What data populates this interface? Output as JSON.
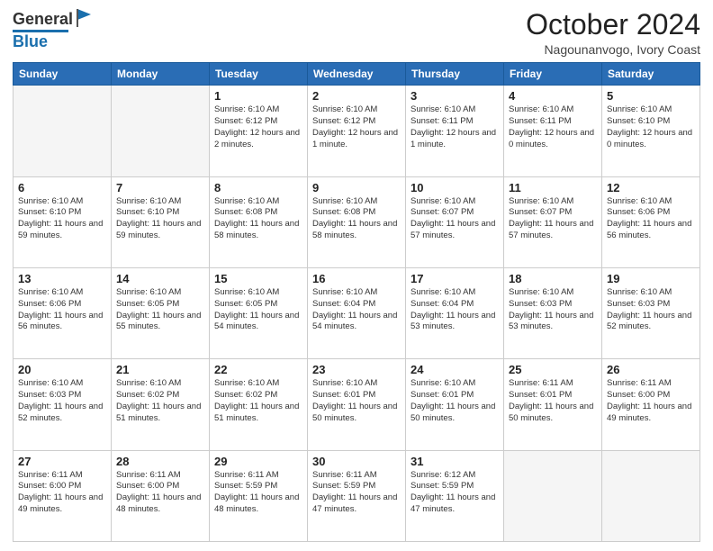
{
  "header": {
    "logo_general": "General",
    "logo_blue": "Blue",
    "month_title": "October 2024",
    "location": "Nagounanvogo, Ivory Coast"
  },
  "days_of_week": [
    "Sunday",
    "Monday",
    "Tuesday",
    "Wednesday",
    "Thursday",
    "Friday",
    "Saturday"
  ],
  "weeks": [
    [
      {
        "day": "",
        "info": ""
      },
      {
        "day": "",
        "info": ""
      },
      {
        "day": "1",
        "info": "Sunrise: 6:10 AM\nSunset: 6:12 PM\nDaylight: 12 hours\nand 2 minutes."
      },
      {
        "day": "2",
        "info": "Sunrise: 6:10 AM\nSunset: 6:12 PM\nDaylight: 12 hours\nand 1 minute."
      },
      {
        "day": "3",
        "info": "Sunrise: 6:10 AM\nSunset: 6:11 PM\nDaylight: 12 hours\nand 1 minute."
      },
      {
        "day": "4",
        "info": "Sunrise: 6:10 AM\nSunset: 6:11 PM\nDaylight: 12 hours\nand 0 minutes."
      },
      {
        "day": "5",
        "info": "Sunrise: 6:10 AM\nSunset: 6:10 PM\nDaylight: 12 hours\nand 0 minutes."
      }
    ],
    [
      {
        "day": "6",
        "info": "Sunrise: 6:10 AM\nSunset: 6:10 PM\nDaylight: 11 hours\nand 59 minutes."
      },
      {
        "day": "7",
        "info": "Sunrise: 6:10 AM\nSunset: 6:10 PM\nDaylight: 11 hours\nand 59 minutes."
      },
      {
        "day": "8",
        "info": "Sunrise: 6:10 AM\nSunset: 6:08 PM\nDaylight: 11 hours\nand 58 minutes."
      },
      {
        "day": "9",
        "info": "Sunrise: 6:10 AM\nSunset: 6:08 PM\nDaylight: 11 hours\nand 58 minutes."
      },
      {
        "day": "10",
        "info": "Sunrise: 6:10 AM\nSunset: 6:07 PM\nDaylight: 11 hours\nand 57 minutes."
      },
      {
        "day": "11",
        "info": "Sunrise: 6:10 AM\nSunset: 6:07 PM\nDaylight: 11 hours\nand 57 minutes."
      },
      {
        "day": "12",
        "info": "Sunrise: 6:10 AM\nSunset: 6:06 PM\nDaylight: 11 hours\nand 56 minutes."
      }
    ],
    [
      {
        "day": "13",
        "info": "Sunrise: 6:10 AM\nSunset: 6:06 PM\nDaylight: 11 hours\nand 56 minutes."
      },
      {
        "day": "14",
        "info": "Sunrise: 6:10 AM\nSunset: 6:05 PM\nDaylight: 11 hours\nand 55 minutes."
      },
      {
        "day": "15",
        "info": "Sunrise: 6:10 AM\nSunset: 6:05 PM\nDaylight: 11 hours\nand 54 minutes."
      },
      {
        "day": "16",
        "info": "Sunrise: 6:10 AM\nSunset: 6:04 PM\nDaylight: 11 hours\nand 54 minutes."
      },
      {
        "day": "17",
        "info": "Sunrise: 6:10 AM\nSunset: 6:04 PM\nDaylight: 11 hours\nand 53 minutes."
      },
      {
        "day": "18",
        "info": "Sunrise: 6:10 AM\nSunset: 6:03 PM\nDaylight: 11 hours\nand 53 minutes."
      },
      {
        "day": "19",
        "info": "Sunrise: 6:10 AM\nSunset: 6:03 PM\nDaylight: 11 hours\nand 52 minutes."
      }
    ],
    [
      {
        "day": "20",
        "info": "Sunrise: 6:10 AM\nSunset: 6:03 PM\nDaylight: 11 hours\nand 52 minutes."
      },
      {
        "day": "21",
        "info": "Sunrise: 6:10 AM\nSunset: 6:02 PM\nDaylight: 11 hours\nand 51 minutes."
      },
      {
        "day": "22",
        "info": "Sunrise: 6:10 AM\nSunset: 6:02 PM\nDaylight: 11 hours\nand 51 minutes."
      },
      {
        "day": "23",
        "info": "Sunrise: 6:10 AM\nSunset: 6:01 PM\nDaylight: 11 hours\nand 50 minutes."
      },
      {
        "day": "24",
        "info": "Sunrise: 6:10 AM\nSunset: 6:01 PM\nDaylight: 11 hours\nand 50 minutes."
      },
      {
        "day": "25",
        "info": "Sunrise: 6:11 AM\nSunset: 6:01 PM\nDaylight: 11 hours\nand 50 minutes."
      },
      {
        "day": "26",
        "info": "Sunrise: 6:11 AM\nSunset: 6:00 PM\nDaylight: 11 hours\nand 49 minutes."
      }
    ],
    [
      {
        "day": "27",
        "info": "Sunrise: 6:11 AM\nSunset: 6:00 PM\nDaylight: 11 hours\nand 49 minutes."
      },
      {
        "day": "28",
        "info": "Sunrise: 6:11 AM\nSunset: 6:00 PM\nDaylight: 11 hours\nand 48 minutes."
      },
      {
        "day": "29",
        "info": "Sunrise: 6:11 AM\nSunset: 5:59 PM\nDaylight: 11 hours\nand 48 minutes."
      },
      {
        "day": "30",
        "info": "Sunrise: 6:11 AM\nSunset: 5:59 PM\nDaylight: 11 hours\nand 47 minutes."
      },
      {
        "day": "31",
        "info": "Sunrise: 6:12 AM\nSunset: 5:59 PM\nDaylight: 11 hours\nand 47 minutes."
      },
      {
        "day": "",
        "info": ""
      },
      {
        "day": "",
        "info": ""
      }
    ]
  ]
}
